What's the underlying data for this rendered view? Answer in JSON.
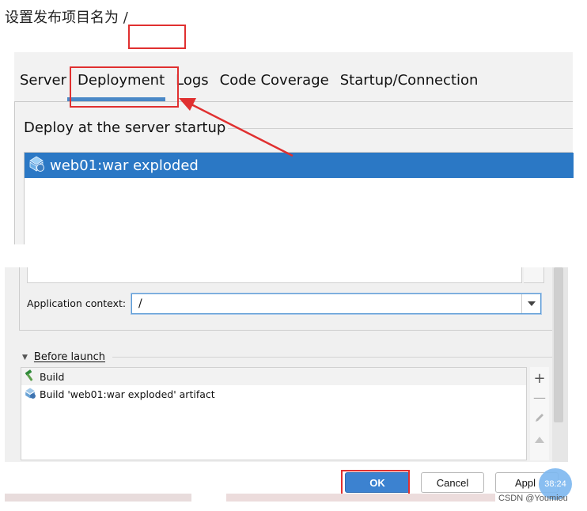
{
  "caption": "设置发布项目名为 /",
  "tabs": [
    "Server",
    "Deployment",
    "Logs",
    "Code Coverage",
    "Startup/Connection"
  ],
  "active_tab": "Deployment",
  "deploy": {
    "title": "Deploy at the server startup",
    "item": "web01:war exploded"
  },
  "context": {
    "label": "Application context:",
    "value": "/"
  },
  "before_launch": {
    "header": "Before launch",
    "items": [
      "Build",
      "Build 'web01:war exploded' artifact"
    ]
  },
  "buttons": {
    "ok": "OK",
    "cancel": "Cancel",
    "apply": "Appl"
  },
  "badge": "38:24",
  "watermark": "CSDN @Youmiou",
  "colors": {
    "selection": "#2b78c5",
    "accent": "#4a88c7",
    "highlight_box": "#e03030",
    "ok_button": "#3c82d0"
  }
}
